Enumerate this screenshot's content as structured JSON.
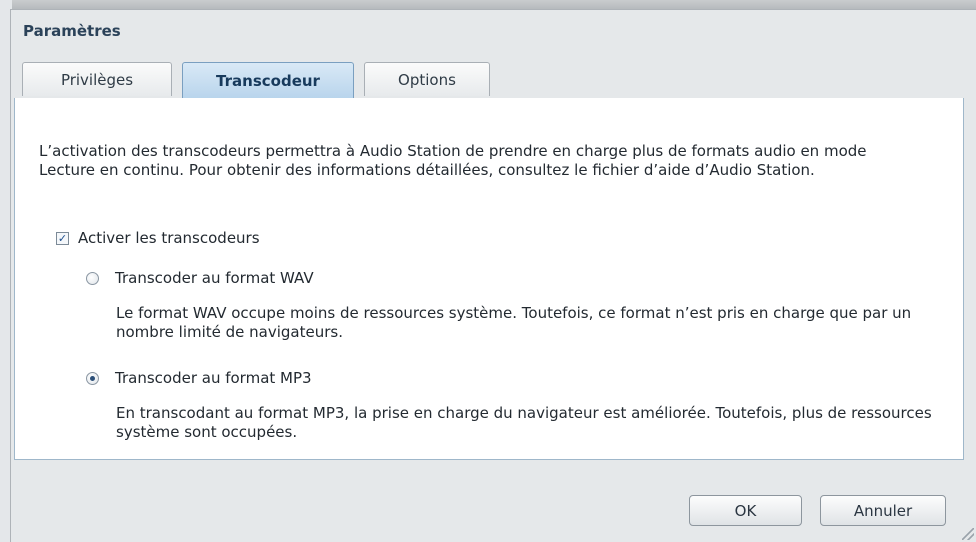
{
  "dialog": {
    "title": "Paramètres",
    "tabs": [
      {
        "label": "Privilèges",
        "active": false
      },
      {
        "label": "Transcodeur",
        "active": true
      },
      {
        "label": "Options",
        "active": false
      }
    ],
    "description": "L’activation des transcodeurs permettra à Audio Station de prendre en charge plus de formats audio en mode Lecture en continu. Pour obtenir des informations détaillées, consultez le fichier d’aide d’Audio Station.",
    "enable_checkbox": {
      "label": "Activer les transcodeurs",
      "checked": true
    },
    "options": [
      {
        "label": "Transcoder au format WAV",
        "selected": false,
        "description": "Le format WAV occupe moins de ressources système. Toutefois, ce format n’est pris en charge que par un nombre limité de navigateurs."
      },
      {
        "label": "Transcoder au format MP3",
        "selected": true,
        "description": "En transcodant au format MP3, la prise en charge du navigateur est améliorée. Toutefois, plus de ressources système sont occupées."
      }
    ],
    "buttons": {
      "ok": "OK",
      "cancel": "Annuler"
    }
  },
  "colors": {
    "active_tab": "#b8d4ec",
    "title_text": "#2b4259",
    "dialog_bg": "#e5e8ea"
  }
}
